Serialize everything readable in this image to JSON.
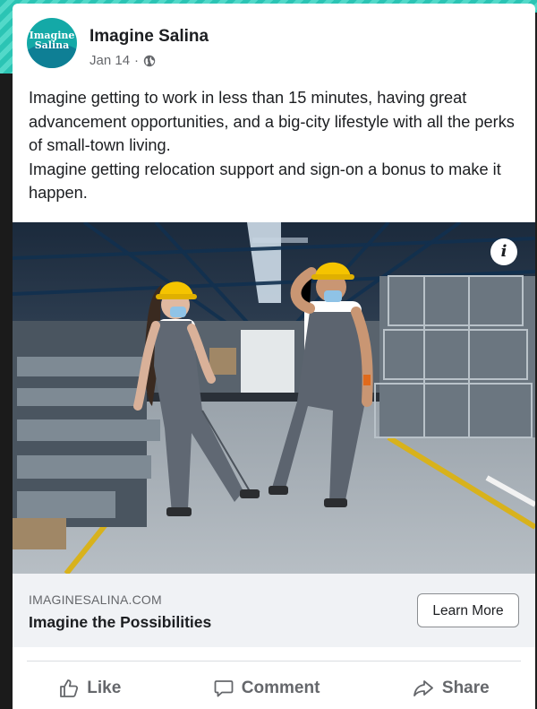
{
  "post": {
    "page_name": "Imagine Salina",
    "date": "Jan 14",
    "separator": "·",
    "privacy_icon": "globe-icon",
    "avatar_text": "Imagine Salina",
    "text": "Imagine getting to work in less than 15 minutes, having great advancement opportunities, and a big-city lifestyle with all the perks of small-town living.\nImagine getting relocation support and sign-on a bonus to make it happen.",
    "photo_info_glyph": "i"
  },
  "link_preview": {
    "domain": "IMAGINESALINA.COM",
    "headline": "Imagine the Possibilities",
    "cta_label": "Learn More"
  },
  "actions": [
    {
      "label": "Like",
      "icon": "thumbs-up-icon"
    },
    {
      "label": "Comment",
      "icon": "comment-bubble-icon"
    },
    {
      "label": "Share",
      "icon": "share-arrow-icon"
    }
  ],
  "colors": {
    "accent_teal": "#2bc4b4",
    "text_primary": "#1c1e21",
    "text_secondary": "#65676b",
    "link_bar_bg": "#f0f2f5",
    "helmet_yellow": "#f5c400"
  }
}
